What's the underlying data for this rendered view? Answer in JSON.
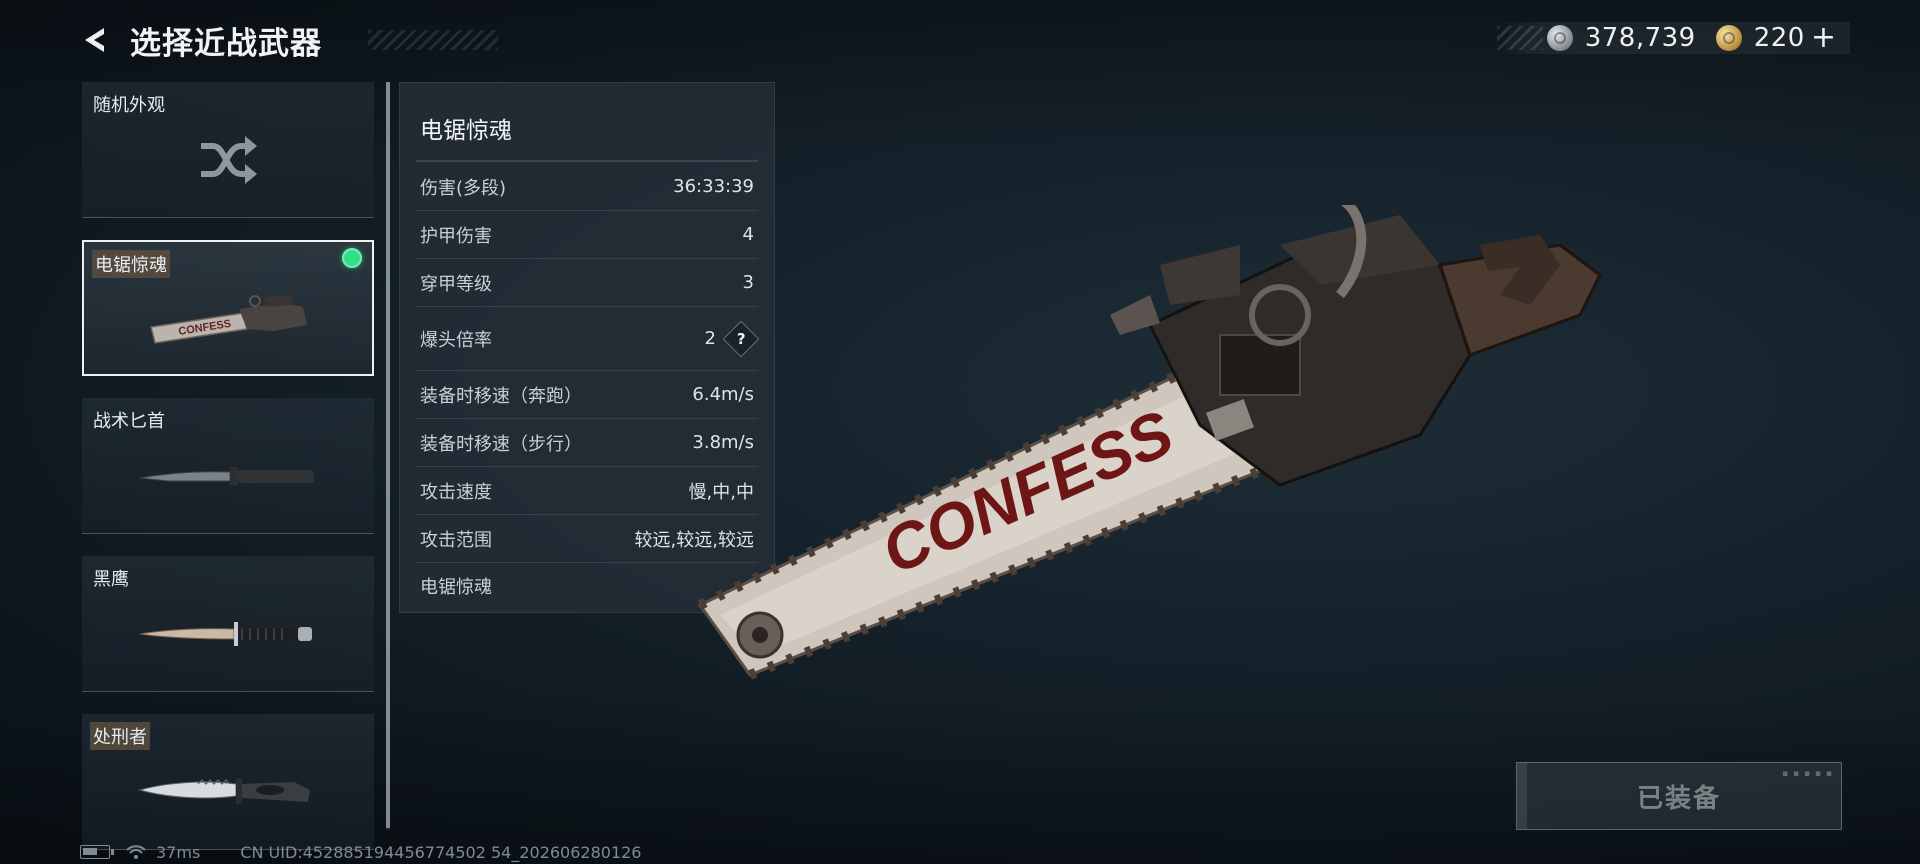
{
  "header": {
    "title": "选择近战武器",
    "currency_silver": "378,739",
    "currency_gold": "220",
    "add_label": "+"
  },
  "weapon_list": [
    {
      "label": "随机外观",
      "icon": "shuffle-icon",
      "selected": false,
      "tagged": false
    },
    {
      "label": "电锯惊魂",
      "icon": "chainsaw-icon",
      "selected": true,
      "equipped": true,
      "tagged": true
    },
    {
      "label": "战术匕首",
      "icon": "tactical-knife-icon",
      "selected": false,
      "tagged": false
    },
    {
      "label": "黑鹰",
      "icon": "combat-knife-icon",
      "selected": false,
      "tagged": false
    },
    {
      "label": "处刑者",
      "icon": "serrated-knife-icon",
      "selected": false,
      "tagged": true
    }
  ],
  "stats": {
    "title": "电锯惊魂",
    "rows": [
      {
        "label": "伤害(多段)",
        "value": "36:33:39"
      },
      {
        "label": "护甲伤害",
        "value": "4"
      },
      {
        "label": "穿甲等级",
        "value": "3"
      },
      {
        "label": "爆头倍率",
        "value": "2",
        "help": "?"
      },
      {
        "label": "装备时移速（奔跑）",
        "value": "6.4m/s"
      },
      {
        "label": "装备时移速（步行）",
        "value": "3.8m/s"
      },
      {
        "label": "攻击速度",
        "value": "慢,中,中"
      },
      {
        "label": "攻击范围",
        "value": "较远,较远,较远"
      }
    ],
    "footer": "电锯惊魂"
  },
  "hero": {
    "graffiti": "CONFESS"
  },
  "equip_button": {
    "label": "已装备"
  },
  "status_bar": {
    "ping": "37ms",
    "uid": "CN UID:452885194456774502 54_202606280126"
  },
  "colors": {
    "equipped_dot": "#2fe08a",
    "panel_bg": "#242e37",
    "background": "#15212a"
  }
}
